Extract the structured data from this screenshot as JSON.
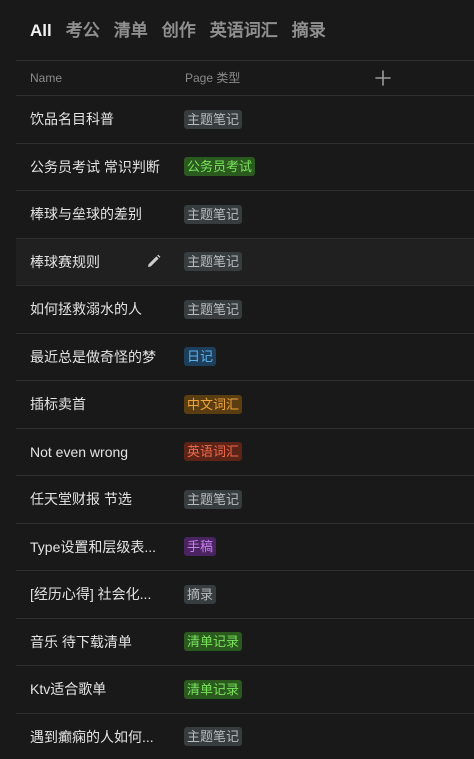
{
  "tabs": [
    {
      "label": "All",
      "active": true
    },
    {
      "label": "考公",
      "active": false
    },
    {
      "label": "清单",
      "active": false
    },
    {
      "label": "创作",
      "active": false
    },
    {
      "label": "英语词汇",
      "active": false
    },
    {
      "label": "摘录",
      "active": false
    }
  ],
  "table": {
    "headers": {
      "name": "Name",
      "type": "Page 类型"
    },
    "add_icon": "plus-icon",
    "rows": [
      {
        "name": "饮品名目科普",
        "type": "主题笔记",
        "color": "gray"
      },
      {
        "name": "公务员考试 常识判断",
        "type": "公务员考试",
        "color": "green"
      },
      {
        "name": "棒球与垒球的差别",
        "type": "主题笔记",
        "color": "gray"
      },
      {
        "name": "棒球赛规则",
        "type": "主题笔记",
        "color": "gray",
        "hover": true,
        "edit_icon": "pencil-icon"
      },
      {
        "name": "如何拯救溺水的人",
        "type": "主题笔记",
        "color": "gray"
      },
      {
        "name": "最近总是做奇怪的梦",
        "type": "日记",
        "color": "blue"
      },
      {
        "name": "插标卖首",
        "type": "中文词汇",
        "color": "orange"
      },
      {
        "name": "Not even wrong",
        "type": "英语词汇",
        "color": "red"
      },
      {
        "name": "任天堂财报 节选",
        "type": "主题笔记",
        "color": "gray"
      },
      {
        "name": "Type设置和层级表...",
        "type": "手稿",
        "color": "purple"
      },
      {
        "name": "[经历心得] 社会化...",
        "type": "摘录",
        "color": "gray"
      },
      {
        "name": "音乐 待下载清单",
        "type": "清单记录",
        "color": "green"
      },
      {
        "name": "Ktv适合歌单",
        "type": "清单记录",
        "color": "green"
      },
      {
        "name": "遇到癫痫的人如何...",
        "type": "主题笔记",
        "color": "gray"
      }
    ]
  },
  "colors": {
    "background": "#191919",
    "divider": "#2f2f2f",
    "tag_gray": "#373c3f",
    "tag_green": "#2b5a1f",
    "tag_blue": "#1d3f5c",
    "tag_orange": "#5a3d10",
    "tag_red": "#5c2417",
    "tag_purple": "#4a2460"
  }
}
